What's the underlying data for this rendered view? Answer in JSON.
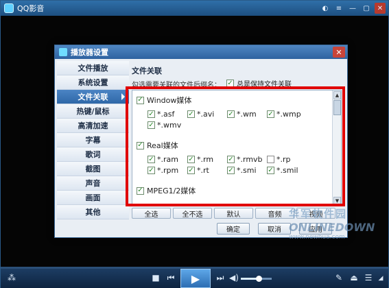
{
  "app": {
    "title": "QQ影音"
  },
  "dialog": {
    "title": "播放器设置",
    "sidebar": [
      {
        "label": "文件播放",
        "active": false
      },
      {
        "label": "系统设置",
        "active": false
      },
      {
        "label": "文件关联",
        "active": true
      },
      {
        "label": "热键/鼠标",
        "active": false
      },
      {
        "label": "高清加速",
        "active": false
      },
      {
        "label": "字幕",
        "active": false
      },
      {
        "label": "歌词",
        "active": false
      },
      {
        "label": "截图",
        "active": false
      },
      {
        "label": "声音",
        "active": false
      },
      {
        "label": "画面",
        "active": false
      },
      {
        "label": "其他",
        "active": false
      }
    ],
    "section_title": "文件关联",
    "hint": "勾选需要关联的文件后缀名：",
    "keep_assoc_label": "总是保持文件关联",
    "groups": [
      {
        "title": "Window媒体",
        "checked": true,
        "exts": [
          {
            "label": "*.asf",
            "checked": true
          },
          {
            "label": "*.avi",
            "checked": true
          },
          {
            "label": "*.wm",
            "checked": true
          },
          {
            "label": "*.wmp",
            "checked": true
          },
          {
            "label": "*.wmv",
            "checked": true
          }
        ]
      },
      {
        "title": "Real媒体",
        "checked": true,
        "exts": [
          {
            "label": "*.ram",
            "checked": true
          },
          {
            "label": "*.rm",
            "checked": true
          },
          {
            "label": "*.rmvb",
            "checked": true
          },
          {
            "label": "*.rp",
            "checked": false
          },
          {
            "label": "*.rpm",
            "checked": true
          },
          {
            "label": "*.rt",
            "checked": true
          },
          {
            "label": "*.smi",
            "checked": true
          },
          {
            "label": "*.smil",
            "checked": true
          }
        ]
      },
      {
        "title": "MPEG1/2媒体",
        "checked": true,
        "exts": []
      }
    ],
    "select_buttons": [
      "全选",
      "全不选",
      "默认",
      "音频",
      "视频"
    ],
    "ok": "确定",
    "cancel": "取消",
    "apply": "应用"
  },
  "watermark": {
    "cn": "华军软件园",
    "en": "ONLINEDOWN",
    "url": "www.newhua.com"
  },
  "icons": {
    "check": "✓",
    "close": "✕",
    "play": "▶",
    "stop": "■",
    "prev": "⏮",
    "next": "⏭"
  }
}
